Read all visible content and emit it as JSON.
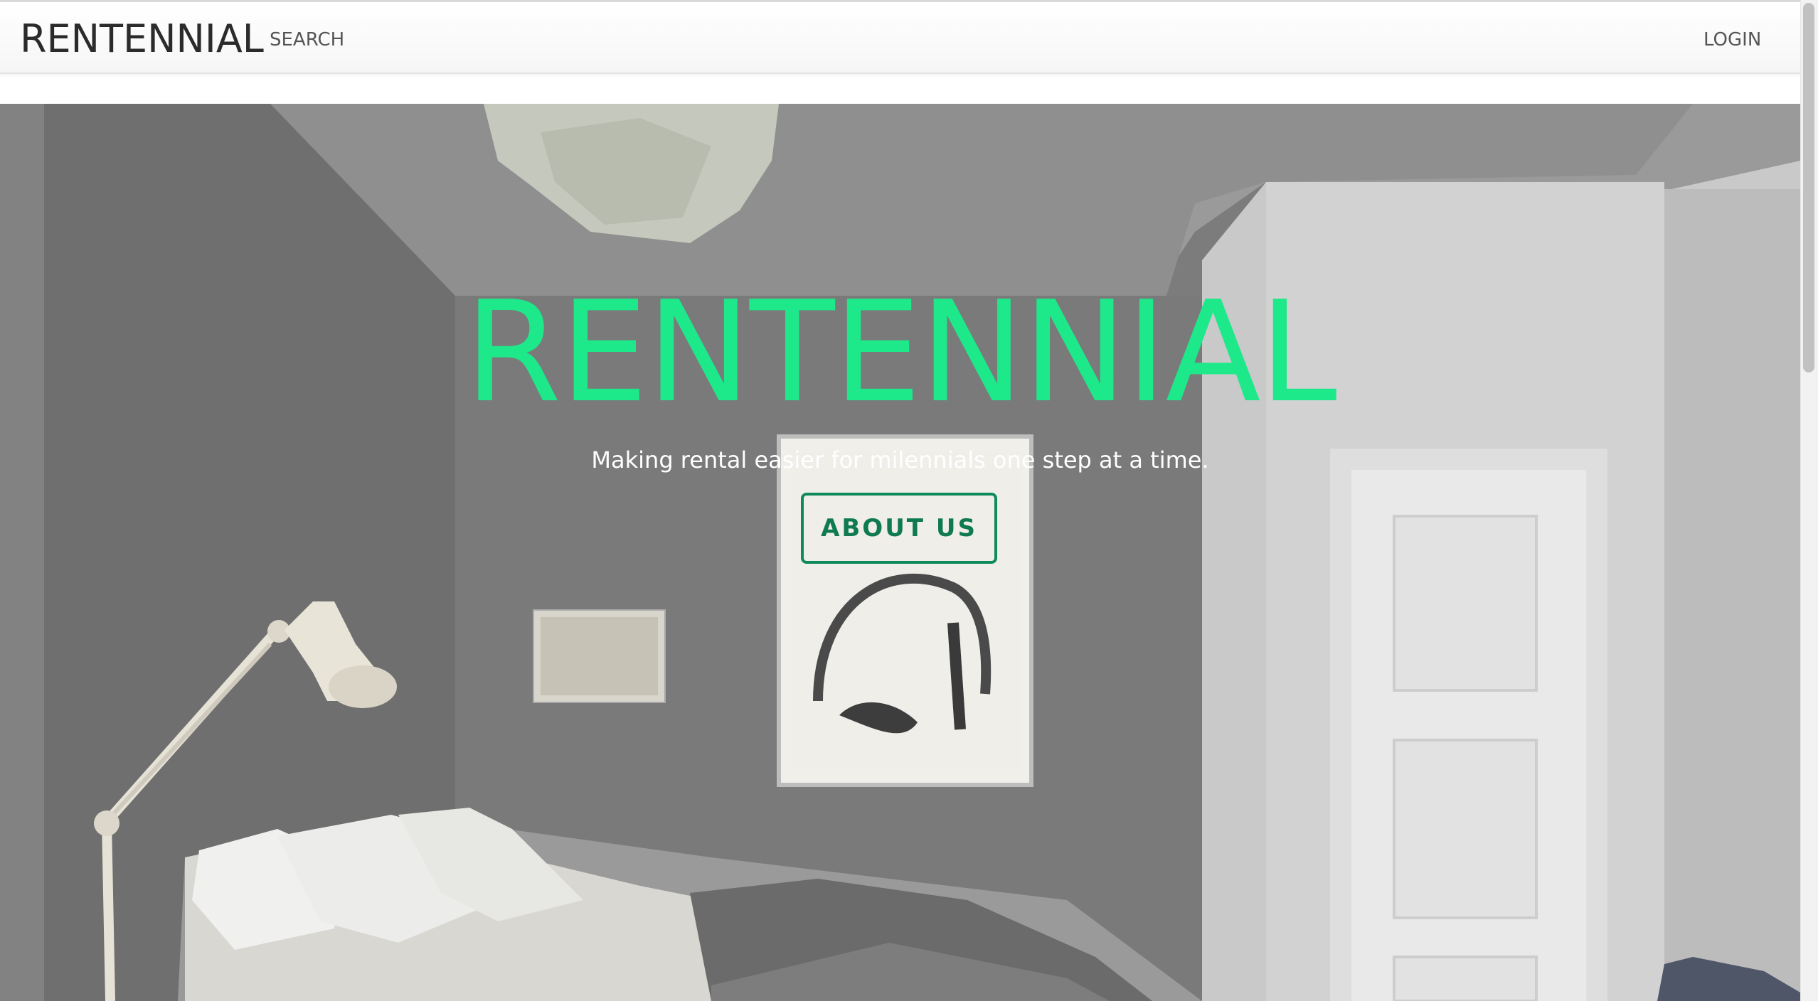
{
  "navbar": {
    "brand": "RENTENNIAL",
    "search_label": "SEARCH",
    "login_label": "LOGIN"
  },
  "hero": {
    "title": "RENTENNIAL",
    "tagline": "Making rental easier for milennials one step at a time.",
    "cta_label": "ABOUT US",
    "title_color": "#1de98b",
    "cta_color": "#0f8a5c"
  }
}
